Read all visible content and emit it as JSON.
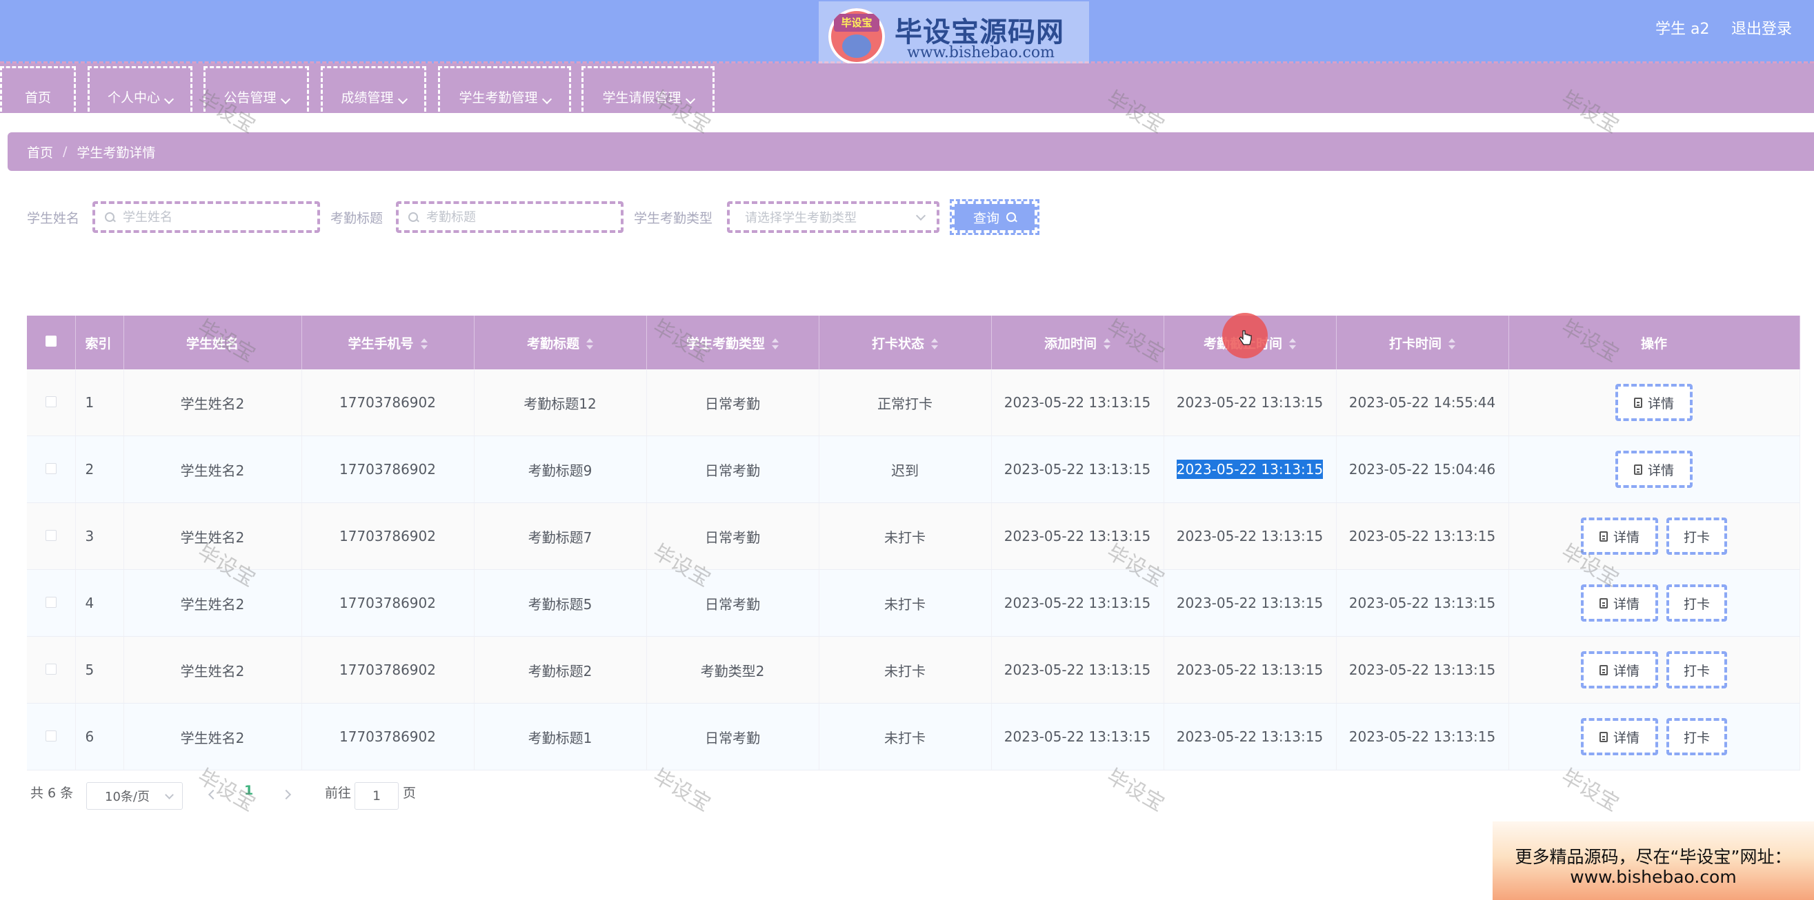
{
  "header": {
    "user_label": "学生 a2",
    "logout_label": "退出登录",
    "logo_badge": "毕设宝",
    "logo_title": "毕设宝源码网",
    "logo_url": "www.bishebao.com"
  },
  "nav": [
    {
      "label": "首页",
      "has_dropdown": false
    },
    {
      "label": "个人中心",
      "has_dropdown": true
    },
    {
      "label": "公告管理",
      "has_dropdown": true
    },
    {
      "label": "成绩管理",
      "has_dropdown": true
    },
    {
      "label": "学生考勤管理",
      "has_dropdown": true
    },
    {
      "label": "学生请假管理",
      "has_dropdown": true
    }
  ],
  "breadcrumb": {
    "home": "首页",
    "separator": "/",
    "current": "学生考勤详情"
  },
  "search": {
    "student_name_label": "学生姓名",
    "student_name_placeholder": "学生姓名",
    "title_label": "考勤标题",
    "title_placeholder": "考勤标题",
    "type_label": "学生考勤类型",
    "type_placeholder": "请选择学生考勤类型",
    "query_label": "查询"
  },
  "table": {
    "columns": [
      "索引",
      "学生姓名",
      "学生手机号",
      "考勤标题",
      "学生考勤类型",
      "打卡状态",
      "添加时间",
      "考勤截止时间",
      "打卡时间",
      "操作"
    ],
    "actions": {
      "detail": "详情",
      "punch": "打卡"
    },
    "rows": [
      {
        "index": "1",
        "name": "学生姓名2",
        "phone": "17703786902",
        "title": "考勤标题12",
        "type": "日常考勤",
        "status": "正常打卡",
        "add_time": "2023-05-22 13:13:15",
        "deadline": "2023-05-22 13:13:15",
        "punch_time": "2023-05-22 14:55:44",
        "can_punch": false
      },
      {
        "index": "2",
        "name": "学生姓名2",
        "phone": "17703786902",
        "title": "考勤标题9",
        "type": "日常考勤",
        "status": "迟到",
        "add_time": "2023-05-22 13:13:15",
        "deadline": "2023-05-22 13:13:15",
        "punch_time": "2023-05-22 15:04:46",
        "can_punch": false
      },
      {
        "index": "3",
        "name": "学生姓名2",
        "phone": "17703786902",
        "title": "考勤标题7",
        "type": "日常考勤",
        "status": "未打卡",
        "add_time": "2023-05-22 13:13:15",
        "deadline": "2023-05-22 13:13:15",
        "punch_time": "2023-05-22 13:13:15",
        "can_punch": true
      },
      {
        "index": "4",
        "name": "学生姓名2",
        "phone": "17703786902",
        "title": "考勤标题5",
        "type": "日常考勤",
        "status": "未打卡",
        "add_time": "2023-05-22 13:13:15",
        "deadline": "2023-05-22 13:13:15",
        "punch_time": "2023-05-22 13:13:15",
        "can_punch": true
      },
      {
        "index": "5",
        "name": "学生姓名2",
        "phone": "17703786902",
        "title": "考勤标题2",
        "type": "考勤类型2",
        "status": "未打卡",
        "add_time": "2023-05-22 13:13:15",
        "deadline": "2023-05-22 13:13:15",
        "punch_time": "2023-05-22 13:13:15",
        "can_punch": true
      },
      {
        "index": "6",
        "name": "学生姓名2",
        "phone": "17703786902",
        "title": "考勤标题1",
        "type": "日常考勤",
        "status": "未打卡",
        "add_time": "2023-05-22 13:13:15",
        "deadline": "2023-05-22 13:13:15",
        "punch_time": "2023-05-22 13:13:15",
        "can_punch": true
      }
    ]
  },
  "pagination": {
    "total_label": "共 6 条",
    "page_size": "10条/页",
    "current_page": "1",
    "goto_label": "前往",
    "goto_value": "1",
    "page_suffix": "页"
  },
  "watermark_text": "毕设宝",
  "promo": {
    "line1": "更多精品源码，尽在“毕设宝”网址：",
    "line2": "www.bishebao.com"
  }
}
